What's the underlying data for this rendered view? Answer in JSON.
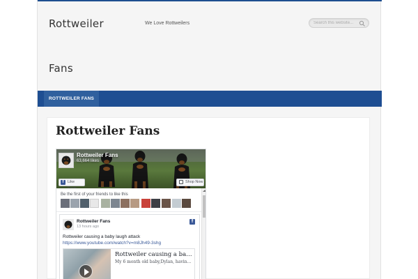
{
  "header": {
    "site_title_line1": "Rottweiler",
    "site_title_line2": "Fans",
    "tagline": "We Love Rottweilers",
    "search_placeholder": "Search this website..."
  },
  "nav": {
    "items": [
      {
        "label": "ROTTWEILER FANS"
      }
    ]
  },
  "main": {
    "page_title": "Rottweiler Fans"
  },
  "fb_widget": {
    "page_name": "Rottweiler Fans",
    "likes": "63,664 likes",
    "like_button": "Like Page",
    "shop_button": "Shop Now",
    "friends_text": "Be the first of your friends to like this",
    "post": {
      "author": "Rottweiler Fans",
      "time": "13 hours ago",
      "text": "Rottweiler causing a baby laugh attack",
      "link": "https://www.youtube.com/watch?v=m8Jh49-3shg",
      "card_title": "Rottweiler causing a baby...",
      "card_desc": "My 6 month old baby,Dylan, having a gig..."
    }
  },
  "colors": {
    "accent": "#1e4e92",
    "facebook": "#3b5998"
  }
}
